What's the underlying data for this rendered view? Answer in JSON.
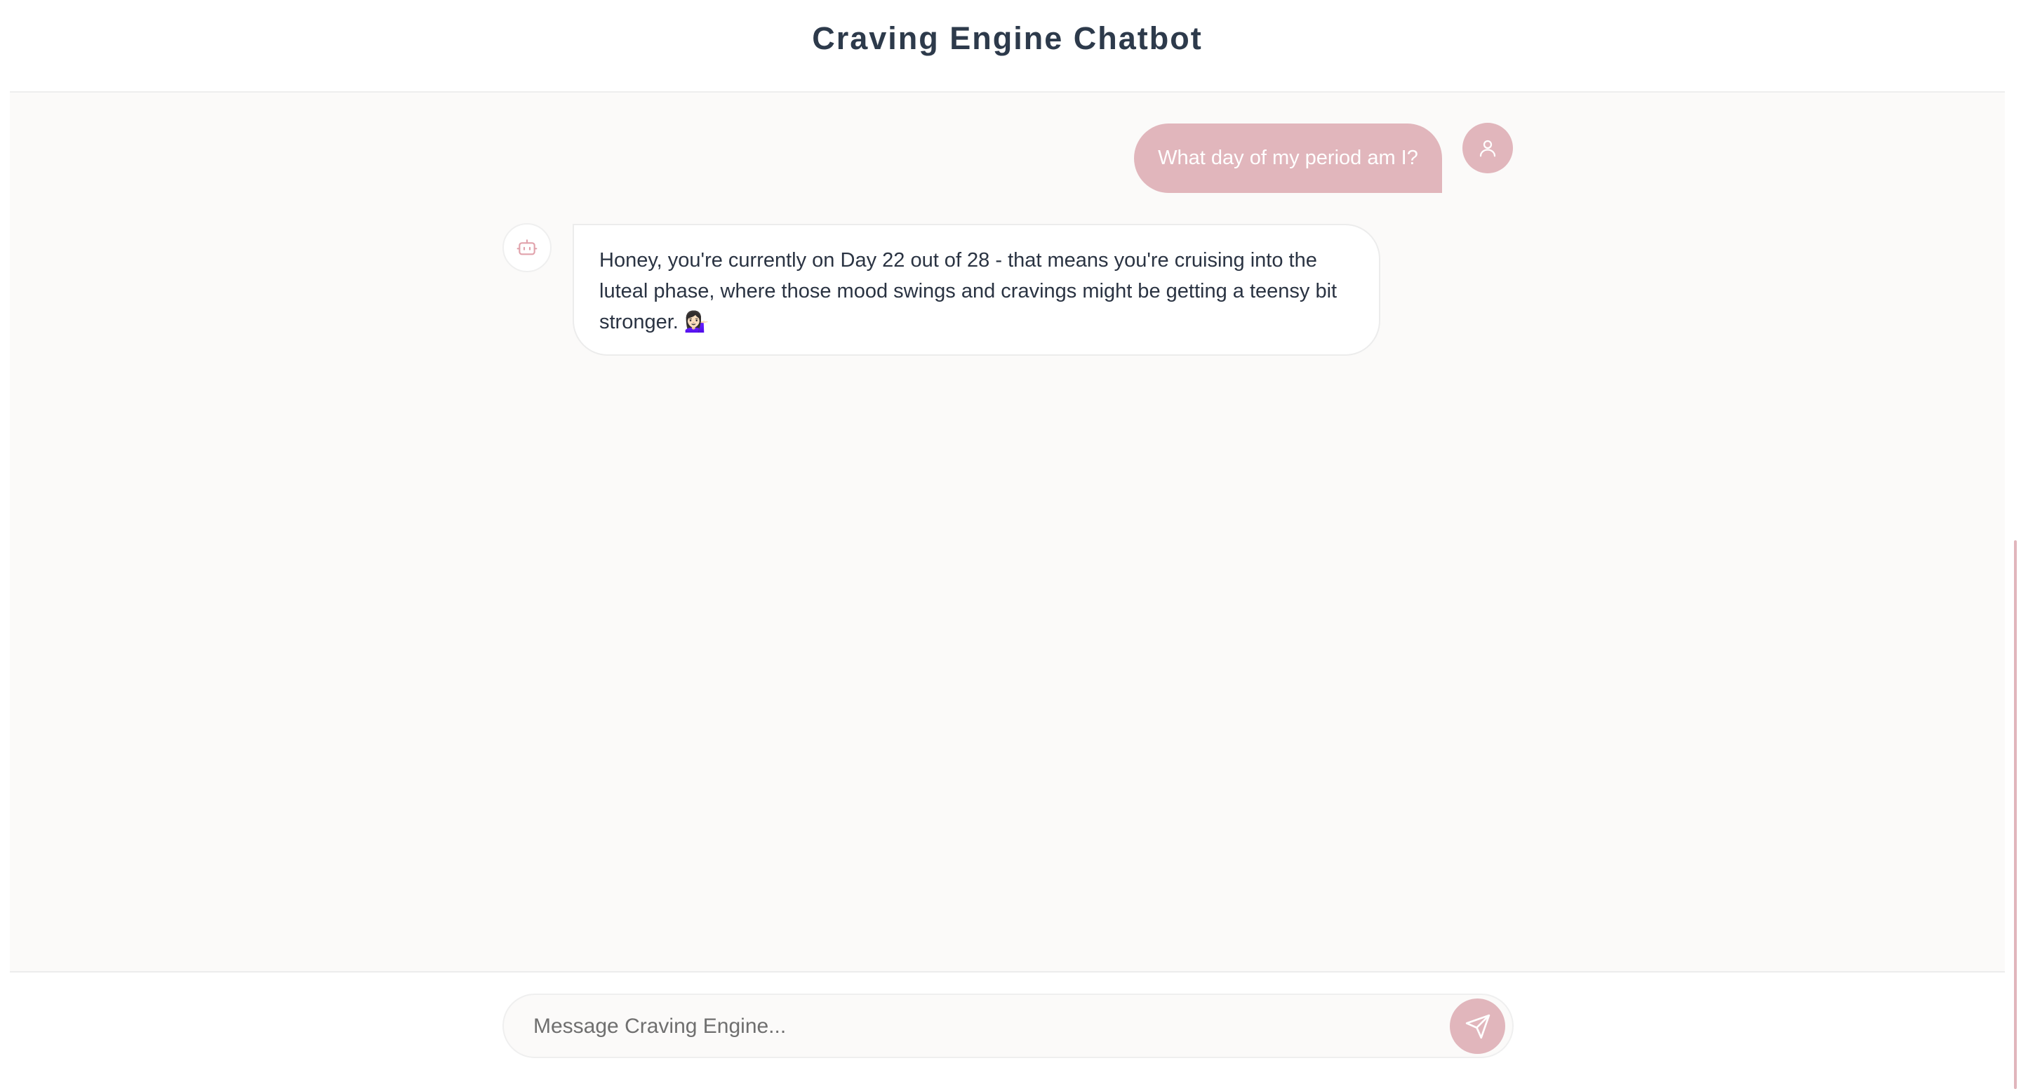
{
  "header": {
    "title": "Craving Engine Chatbot"
  },
  "messages": [
    {
      "role": "user",
      "avatar_icon": "user-icon",
      "text": "What day of my period am I?"
    },
    {
      "role": "bot",
      "avatar_icon": "robot-icon",
      "text": "Honey, you're currently on Day 22 out of 28 - that means you're cruising into the luteal phase, where those mood swings and cravings might be getting a teensy bit stronger. 💁🏻‍♀️"
    }
  ],
  "composer": {
    "placeholder": "Message Craving Engine...",
    "value": "",
    "send_icon": "send-icon"
  },
  "colors": {
    "accent": "#e1b6bc",
    "title_text": "#2d3a4b",
    "body_text": "#2a3342",
    "chat_background": "#fbfaf9"
  }
}
